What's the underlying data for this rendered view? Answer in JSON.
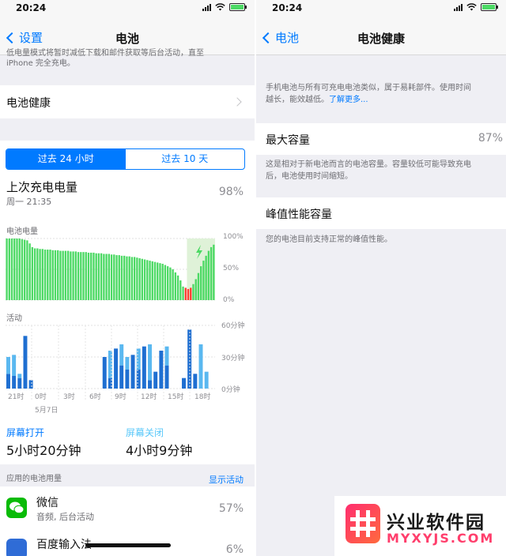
{
  "left": {
    "status_time": "20:24",
    "nav_back": "设置",
    "nav_title": "电池",
    "top_note_line1": "低电量模式将暂时减低下载和邮件获取等后台活动，直至",
    "top_note_line2": "iPhone 完全充电。",
    "battery_health_label": "电池健康",
    "segments": [
      "过去 24 小时",
      "过去 10 天"
    ],
    "last_charge_label": "上次充电电量",
    "last_charge_time": "周一 21:35",
    "last_charge_value": "98%",
    "battery_level_label": "电池电量",
    "battery_axis": [
      "100%",
      "50%",
      "0%"
    ],
    "activity_label": "活动",
    "activity_axis": [
      "60分钟",
      "30分钟",
      "0分钟"
    ],
    "time_ticks": [
      "21时",
      "0时",
      "3时",
      "6时",
      "9时",
      "12时",
      "15时",
      "18时"
    ],
    "date_label": "5月7日",
    "screen_on_label": "屏幕打开",
    "screen_on_value": "5小时20分钟",
    "screen_off_label": "屏幕关闭",
    "screen_off_value": "4小时9分钟",
    "app_usage_label": "应用的电池用量",
    "show_activity_label": "显示活动",
    "apps": [
      {
        "name": "微信",
        "detail": "音频, 后台活动",
        "percent": "57%",
        "color": "#09bb07"
      },
      {
        "name": "百度输入法",
        "detail": "",
        "percent": "6%",
        "color": "#2f6cd6"
      }
    ]
  },
  "right": {
    "status_time": "20:24",
    "nav_back": "电池",
    "nav_title": "电池健康",
    "intro_line1": "手机电池与所有可充电电池类似，属于易耗部件。使用时间",
    "intro_line2_prefix": "越长，能效越低。",
    "intro_link": "了解更多...",
    "max_capacity_label": "最大容量",
    "max_capacity_value": "87%",
    "capacity_note_line1": "这是相对于新电池而言的电池容量。容量较低可能导致充电",
    "capacity_note_line2": "后，电池使用时间缩短。",
    "peak_label": "峰值性能容量",
    "peak_note": "您的电池目前支持正常的峰值性能。"
  },
  "watermark": {
    "cn": "兴业软件园",
    "en": "MYXYJS.COM"
  },
  "chart_data": [
    {
      "type": "bar",
      "title": "电池电量",
      "ylim": [
        0,
        100
      ],
      "ytick_labels": [
        "0%",
        "50%",
        "100%"
      ],
      "values": [
        100,
        100,
        100,
        100,
        100,
        100,
        99,
        98,
        97,
        92,
        86,
        84,
        84,
        83,
        83,
        82,
        82,
        82,
        81,
        81,
        81,
        80,
        80,
        80,
        80,
        79,
        79,
        79,
        78,
        78,
        78,
        78,
        77,
        77,
        77,
        76,
        76,
        76,
        75,
        75,
        75,
        74,
        74,
        73,
        73,
        72,
        72,
        71,
        71,
        70,
        70,
        69,
        68,
        67,
        66,
        65,
        64,
        63,
        62,
        61,
        60,
        59,
        57,
        55,
        53,
        50,
        45,
        40,
        32,
        22,
        20,
        18,
        20,
        26,
        34,
        44,
        55,
        64,
        72,
        80,
        86,
        90
      ],
      "low_threshold": 20,
      "charging_from_index": 71
    },
    {
      "type": "bar",
      "title": "活动",
      "ylim": [
        0,
        60
      ],
      "ytick_labels": [
        "0分钟",
        "30分钟",
        "60分钟"
      ],
      "series": [
        {
          "name": "屏幕打开",
          "values": [
            14,
            12,
            10,
            50,
            8,
            0,
            0,
            0,
            0,
            0,
            0,
            0,
            0,
            0,
            0,
            0,
            0,
            30,
            10,
            38,
            22,
            18,
            32,
            18,
            40,
            8,
            16,
            36,
            22,
            0,
            0,
            10,
            56,
            14,
            0,
            0,
            0
          ]
        },
        {
          "name": "屏幕关闭",
          "values": [
            16,
            20,
            4,
            0,
            0,
            0,
            0,
            0,
            0,
            0,
            0,
            0,
            0,
            0,
            0,
            0,
            0,
            0,
            26,
            0,
            20,
            12,
            0,
            20,
            0,
            34,
            0,
            0,
            18,
            0,
            0,
            0,
            0,
            0,
            42,
            16,
            0
          ]
        }
      ]
    }
  ]
}
